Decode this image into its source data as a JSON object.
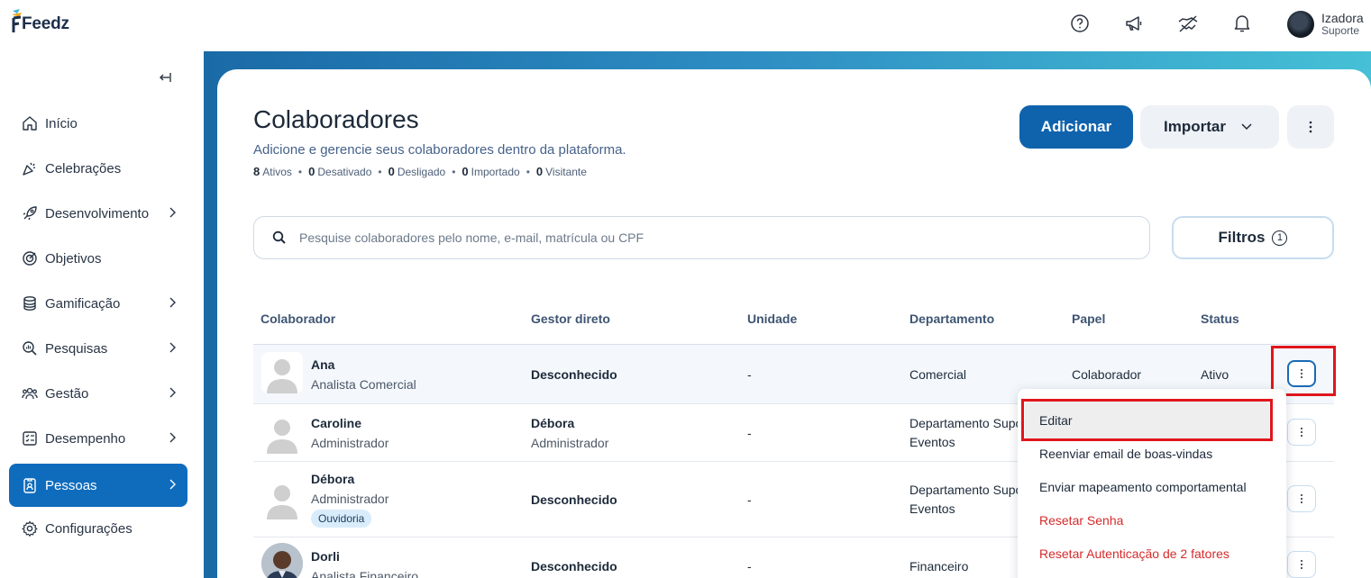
{
  "app": {
    "name": "Feedz"
  },
  "topbar": {
    "icons": [
      "help-icon",
      "megaphone-icon",
      "handshake-icon",
      "bell-icon"
    ],
    "user": {
      "name": "Izadora",
      "role": "Suporte"
    }
  },
  "sidebar": {
    "items": [
      {
        "label": "Início",
        "icon": "home-icon",
        "chevron": false
      },
      {
        "label": "Celebrações",
        "icon": "party-icon",
        "chevron": false
      },
      {
        "label": "Desenvolvimento",
        "icon": "rocket-icon",
        "chevron": true
      },
      {
        "label": "Objetivos",
        "icon": "target-icon",
        "chevron": false
      },
      {
        "label": "Gamificação",
        "icon": "coins-icon",
        "chevron": true
      },
      {
        "label": "Pesquisas",
        "icon": "search-chart-icon",
        "chevron": true
      },
      {
        "label": "Gestão",
        "icon": "team-icon",
        "chevron": true
      },
      {
        "label": "Desempenho",
        "icon": "checklist-icon",
        "chevron": true
      },
      {
        "label": "Pessoas",
        "icon": "badge-icon",
        "chevron": true,
        "active": true
      },
      {
        "label": "Configurações",
        "icon": "gear-icon",
        "chevron": false
      }
    ]
  },
  "page": {
    "title": "Colaboradores",
    "subtitle": "Adicione e gerencie seus colaboradores dentro da plataforma.",
    "stats": [
      {
        "count": "8",
        "label": "Ativos"
      },
      {
        "count": "0",
        "label": "Desativado"
      },
      {
        "count": "0",
        "label": "Desligado"
      },
      {
        "count": "0",
        "label": "Importado"
      },
      {
        "count": "0",
        "label": "Visitante"
      }
    ],
    "add_label": "Adicionar",
    "import_label": "Importar",
    "search_placeholder": "Pesquise colaboradores pelo nome, e-mail, matrícula ou CPF",
    "filter_label": "Filtros",
    "filter_count": "1"
  },
  "table": {
    "headers": [
      "Colaborador",
      "Gestor direto",
      "Unidade",
      "Departamento",
      "Papel",
      "Status"
    ],
    "rows": [
      {
        "name": "Ana",
        "role": "Analista Comercial",
        "manager": "Desconhecido",
        "manager_role": "",
        "unit": "-",
        "dept": "Comercial",
        "dept2": "",
        "papel": "Colaborador",
        "status": "Ativo",
        "tag": ""
      },
      {
        "name": "Caroline",
        "role": "Administrador",
        "manager": "Débora",
        "manager_role": "Administrador",
        "unit": "-",
        "dept": "Departamento Suporte",
        "dept2": "Eventos",
        "papel": "",
        "status": "",
        "tag": ""
      },
      {
        "name": "Débora",
        "role": "Administrador",
        "manager": "Desconhecido",
        "manager_role": "",
        "unit": "-",
        "dept": "Departamento Suporte",
        "dept2": "Eventos",
        "papel": "",
        "status": "",
        "tag": "Ouvidoria"
      },
      {
        "name": "Dorli",
        "role": "Analista Financeiro",
        "manager": "Desconhecido",
        "manager_role": "",
        "unit": "-",
        "dept": "Financeiro",
        "dept2": "",
        "papel": "",
        "status": "",
        "tag": ""
      }
    ]
  },
  "menu": {
    "items": [
      {
        "label": "Editar",
        "danger": false
      },
      {
        "label": "Reenviar email de boas-vindas",
        "danger": false
      },
      {
        "label": "Enviar mapeamento comportamental",
        "danger": false
      },
      {
        "label": "Resetar Senha",
        "danger": true
      },
      {
        "label": "Resetar Autenticação de 2 fatores",
        "danger": true
      }
    ]
  },
  "colors": {
    "primary": "#0f63ad",
    "danger": "#d62b2b",
    "highlight": "#e0161c"
  }
}
